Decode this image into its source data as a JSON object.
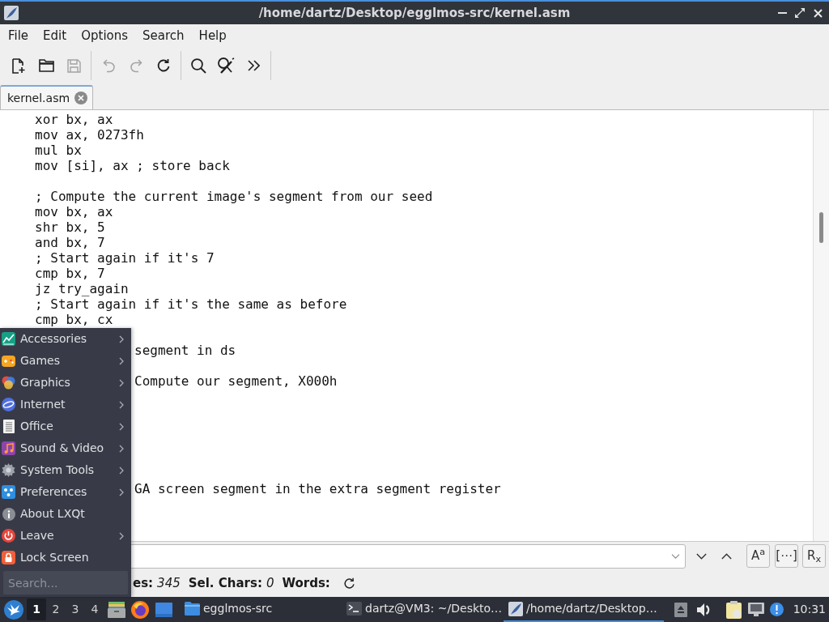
{
  "window": {
    "title": "/home/dartz/Desktop/egglmos-src/kernel.asm"
  },
  "menu_bar": [
    "File",
    "Edit",
    "Options",
    "Search",
    "Help"
  ],
  "toolbar": [
    [
      {
        "disabled": false
      },
      {
        "disabled": false
      },
      {
        "disabled": true
      }
    ],
    [
      {
        "disabled": true
      },
      {
        "disabled": true
      },
      {
        "disabled": false
      }
    ],
    [
      {
        "disabled": false
      },
      {
        "disabled": false
      },
      {
        "disabled": false
      }
    ]
  ],
  "tabs": [
    {
      "label": "kernel.asm",
      "selected": true
    }
  ],
  "editor": {
    "lines": [
      {
        "kind": "code",
        "text": "xor bx, ax"
      },
      {
        "kind": "code",
        "text": "mov ax, 0273fh"
      },
      {
        "kind": "code",
        "text": "mul bx"
      },
      {
        "kind": "code",
        "text": "mov [si], ax ; store back"
      },
      {
        "kind": "blank"
      },
      {
        "kind": "code",
        "text": "; Compute the current image's segment from our seed"
      },
      {
        "kind": "code",
        "text": "mov bx, ax"
      },
      {
        "kind": "code",
        "text": "shr bx, 5"
      },
      {
        "kind": "code",
        "text": "and bx, 7"
      },
      {
        "kind": "code",
        "text": "; Start again if it's 7"
      },
      {
        "kind": "code",
        "text": "cmp bx, 7"
      },
      {
        "kind": "code",
        "text": "jz try_again"
      },
      {
        "kind": "code",
        "text": "; Start again if it's the same as before"
      },
      {
        "kind": "code",
        "text": "cmp bx, cx"
      },
      {
        "kind": "blank"
      },
      {
        "kind": "clipped",
        "text": "segment in ds"
      },
      {
        "kind": "blank"
      },
      {
        "kind": "clipped",
        "text": "Compute our segment, X000h"
      },
      {
        "kind": "blank"
      },
      {
        "kind": "blank"
      },
      {
        "kind": "blank"
      },
      {
        "kind": "blank"
      },
      {
        "kind": "blank"
      },
      {
        "kind": "blank"
      },
      {
        "kind": "clipped",
        "text": "GA screen segment in the extra segment register"
      }
    ]
  },
  "find_bar": {
    "toggles": [
      "A$^{a}$",
      "[⋯]",
      "R$_{x}$"
    ]
  },
  "status_bar": [
    {
      "label": "es:",
      "value": "345"
    },
    {
      "label": "Sel. Chars:",
      "value": "0"
    },
    {
      "label": "Words:"
    }
  ],
  "start_menu": {
    "items": [
      {
        "label": "Accessories",
        "submenu": true
      },
      {
        "label": "Games",
        "submenu": true
      },
      {
        "label": "Graphics",
        "submenu": true
      },
      {
        "label": "Internet",
        "submenu": true
      },
      {
        "label": "Office",
        "submenu": true
      },
      {
        "label": "Sound & Video",
        "submenu": true
      },
      {
        "label": "System Tools",
        "submenu": true
      },
      {
        "label": "Preferences",
        "submenu": true
      },
      {
        "label": "About LXQt",
        "submenu": false
      },
      {
        "label": "Leave",
        "submenu": true
      },
      {
        "label": "Lock Screen",
        "submenu": false
      }
    ],
    "search": {
      "placeholder": "Search..."
    }
  },
  "taskbar": {
    "desktops": [
      {
        "label": "1",
        "selected": true
      },
      {
        "label": "2",
        "selected": false
      },
      {
        "label": "3",
        "selected": false
      },
      {
        "label": "4",
        "selected": false
      }
    ],
    "tasks": [
      {
        "label": "egglmos-src",
        "selected": false
      },
      {
        "label": "dartz@VM3: ~/Deskto…",
        "selected": false
      },
      {
        "label": "/home/dartz/Desktop…",
        "selected": true
      }
    ],
    "clock": "10:31"
  }
}
